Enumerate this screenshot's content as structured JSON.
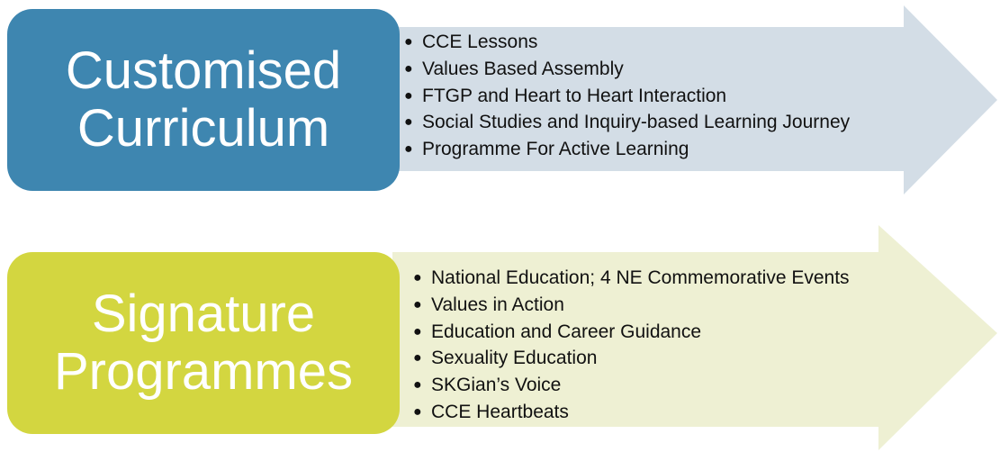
{
  "colors": {
    "blue_box": "#3e86b0",
    "blue_arrow": "#d3dde6",
    "green_box": "#d3d640",
    "green_arrow": "#eef0d3",
    "text_white": "#ffffff",
    "text_dark": "#111111"
  },
  "sections": [
    {
      "title_line1": "Customised",
      "title_line2": "Curriculum",
      "items": [
        "CCE Lessons",
        "Values Based Assembly",
        "FTGP and Heart to Heart Interaction",
        "Social Studies and Inquiry-based Learning Journey",
        "Programme For Active Learning"
      ]
    },
    {
      "title_line1": "Signature",
      "title_line2": "Programmes",
      "items": [
        "National Education; 4 NE Commemorative Events",
        "Values in Action",
        "Education and Career Guidance",
        "Sexuality Education",
        "SKGian’s Voice",
        "CCE Heartbeats"
      ]
    }
  ]
}
